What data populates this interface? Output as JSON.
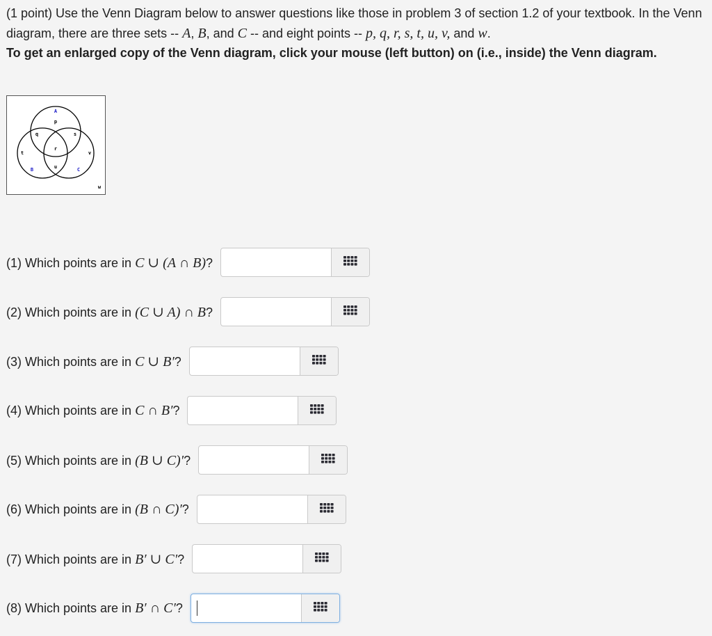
{
  "intro": {
    "prefix": "(1 point) Use the Venn Diagram below to answer questions like those in problem 3 of section 1.2 of your textbook. In the Venn diagram, there are three sets -- ",
    "set_A": "A",
    "sep1": ", ",
    "set_B": "B",
    "sep2": ", and ",
    "set_C": "C",
    "mid": " -- and eight points -- ",
    "points_list": "p, q, r, s, t, u, v,",
    "and_word": " and ",
    "point_w": "w",
    "end": ".",
    "bold_note": "To get an enlarged copy of the Venn diagram, click your mouse (left button) on (i.e., inside) the Venn diagram."
  },
  "venn": {
    "set_labels": [
      "A",
      "B",
      "C"
    ],
    "point_labels": [
      "p",
      "q",
      "s",
      "r",
      "t",
      "v",
      "u",
      "w"
    ],
    "set_label_color": "#1c1cc8"
  },
  "questions": [
    {
      "label": "(1) Which points are in ",
      "expr": "C ∪ (A ∩ B)",
      "suffix": "?",
      "value": ""
    },
    {
      "label": "(2) Which points are in ",
      "expr": "(C ∪ A) ∩ B",
      "suffix": "?",
      "value": ""
    },
    {
      "label": "(3) Which points are in ",
      "expr": "C ∪ B′",
      "suffix": "?",
      "value": ""
    },
    {
      "label": "(4) Which points are in ",
      "expr": "C ∩ B′",
      "suffix": "?",
      "value": ""
    },
    {
      "label": "(5) Which points are in ",
      "expr": "(B ∪ C)′",
      "suffix": "?",
      "value": ""
    },
    {
      "label": "(6) Which points are in ",
      "expr": "(B ∩ C)′",
      "suffix": "?",
      "value": ""
    },
    {
      "label": "(7) Which points are in ",
      "expr": "B′ ∪ C′",
      "suffix": "?",
      "value": ""
    },
    {
      "label": "(8) Which points are in ",
      "expr": "B′ ∩ C′",
      "suffix": "?",
      "value": ""
    }
  ],
  "icons": {
    "answer_button": "grid-icon"
  }
}
